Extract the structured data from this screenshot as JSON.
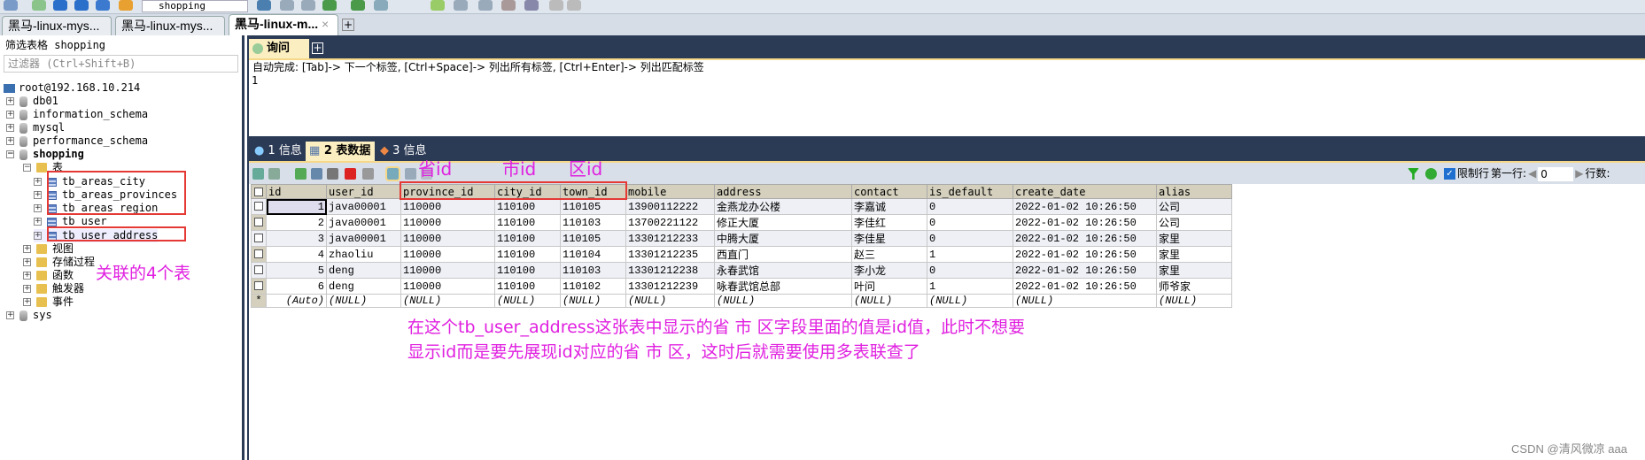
{
  "toolbar": {
    "db_selector": "shopping"
  },
  "connection_tabs": [
    {
      "label": "黑马-linux-mys..."
    },
    {
      "label": "黑马-linux-mys..."
    },
    {
      "label": "黑马-linux-m...",
      "active": true
    }
  ],
  "left_panel": {
    "header": "筛选表格 shopping",
    "filter_placeholder": "过滤器 (Ctrl+Shift+B)",
    "root": "root@192.168.10.214",
    "databases": [
      "db01",
      "information_schema",
      "mysql",
      "performance_schema",
      "shopping"
    ],
    "tables_folder": "表",
    "tables": [
      "tb_areas_city",
      "tb_areas_provinces",
      "tb_areas_region",
      "tb_user",
      "tb_user_address"
    ],
    "folders": [
      "视图",
      "存储过程",
      "函数",
      "触发器",
      "事件"
    ],
    "sys": "sys"
  },
  "query": {
    "tab_label": "询问",
    "autocomplete_hint": "自动完成: [Tab]-> 下一个标签, [Ctrl+Space]-> 列出所有标签, [Ctrl+Enter]-> 列出匹配标签",
    "line_number": "1"
  },
  "result_tabs": [
    {
      "label": "1 信息"
    },
    {
      "label": "2 表数据",
      "active": true
    },
    {
      "label": "3 信息"
    }
  ],
  "result_toolbar": {
    "limit_rows_label": "限制行",
    "limit_checked": true,
    "first_row_label": "第一行:",
    "first_row_value": "0",
    "row_count_label": "行数:"
  },
  "grid": {
    "columns": [
      "id",
      "user_id",
      "province_id",
      "city_id",
      "town_id",
      "mobile",
      "address",
      "contact",
      "is_default",
      "create_date",
      "alias"
    ],
    "rows": [
      [
        "1",
        "java00001",
        "110000",
        "110100",
        "110105",
        "13900112222",
        "金燕龙办公楼",
        "李嘉诚",
        "0",
        "2022-01-02 10:26:50",
        "公司"
      ],
      [
        "2",
        "java00001",
        "110000",
        "110100",
        "110103",
        "13700221122",
        "修正大厦",
        "李佳红",
        "0",
        "2022-01-02 10:26:50",
        "公司"
      ],
      [
        "3",
        "java00001",
        "110000",
        "110100",
        "110105",
        "13301212233",
        "中腾大厦",
        "李佳星",
        "0",
        "2022-01-02 10:26:50",
        "家里"
      ],
      [
        "4",
        "zhaoliu",
        "110000",
        "110100",
        "110104",
        "13301212235",
        "西直门",
        "赵三",
        "1",
        "2022-01-02 10:26:50",
        "家里"
      ],
      [
        "5",
        "deng",
        "110000",
        "110100",
        "110103",
        "13301212238",
        "永春武馆",
        "李小龙",
        "0",
        "2022-01-02 10:26:50",
        "家里"
      ],
      [
        "6",
        "deng",
        "110000",
        "110100",
        "110102",
        "13301212239",
        "咏春武馆总部",
        "叶问",
        "1",
        "2022-01-02 10:26:50",
        "师爷家"
      ]
    ],
    "new_row": {
      "marker": "*",
      "id": "(Auto)",
      "null": "(NULL)"
    }
  },
  "annotations": {
    "province": "省id",
    "city": "市id",
    "town": "区id",
    "tables_note": "关联的4个表",
    "explanation_line1": "在这个tb_user_address这张表中显示的省 市 区字段里面的值是id值，此时不想要",
    "explanation_line2": "显示id而是要先展现id对应的省 市 区，这时后就需要使用多表联查了",
    "color": "#e020e0",
    "box_color": "#e53935"
  },
  "watermark": "CSDN @清风微凉 aaa"
}
